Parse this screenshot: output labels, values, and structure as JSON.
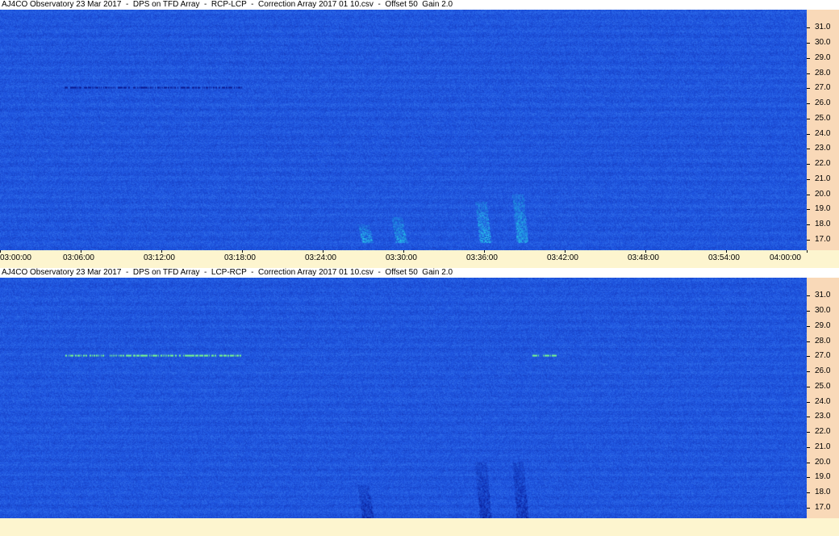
{
  "chart_data": [
    {
      "type": "heatmap",
      "title": "AJ4CO Observatory 23 Mar 2017  -  DPS on TFD Array  -  RCP-LCP  -  Correction Array 2017 01 10.csv  -  Offset 50  Gain 2.0",
      "xlabel": "",
      "ylabel": "",
      "x_ticks": [
        "03:00:00",
        "03:06:00",
        "03:12:00",
        "03:18:00",
        "03:24:00",
        "03:30:00",
        "03:36:00",
        "03:42:00",
        "03:48:00",
        "03:54:00",
        "04:00:00"
      ],
      "y_ticks": [
        "31.0",
        "30.0",
        "29.0",
        "28.0",
        "27.0",
        "26.0",
        "25.0",
        "24.0",
        "23.0",
        "22.0",
        "21.0",
        "20.0",
        "19.0",
        "18.0",
        "17.0"
      ],
      "ylim": [
        16.3,
        32.2
      ],
      "colors": {
        "base": "#1e55e0",
        "bright": "#2ee8f0",
        "dark": "#0a1890"
      },
      "features": [
        {
          "kind": "dark-line",
          "freq": 27.1,
          "x_start": 0.08,
          "x_end": 0.3
        },
        {
          "kind": "burst",
          "time": "03:27:00",
          "freq_range": [
            16.8,
            18.0
          ]
        },
        {
          "kind": "burst",
          "time": "03:29:30",
          "freq_range": [
            16.8,
            18.5
          ]
        },
        {
          "kind": "burst",
          "time": "03:35:45",
          "freq_range": [
            16.8,
            19.5
          ]
        },
        {
          "kind": "burst",
          "time": "03:38:30",
          "freq_range": [
            16.8,
            20.0
          ]
        }
      ]
    },
    {
      "type": "heatmap",
      "title": "AJ4CO Observatory 23 Mar 2017  -  DPS on TFD Array  -  LCP-RCP  -  Correction Array 2017 01 10.csv  -  Offset 50  Gain 2.0",
      "xlabel": "",
      "ylabel": "",
      "x_ticks": [],
      "y_ticks": [
        "31.0",
        "30.0",
        "29.0",
        "28.0",
        "27.0",
        "26.0",
        "25.0",
        "24.0",
        "23.0",
        "22.0",
        "21.0",
        "20.0",
        "19.0",
        "18.0",
        "17.0"
      ],
      "ylim": [
        16.3,
        32.2
      ],
      "colors": {
        "base": "#1e55e0",
        "bright": "#7dff8a",
        "dark": "#0a1890"
      },
      "features": [
        {
          "kind": "bright-line",
          "freq": 27.1,
          "x_start": 0.08,
          "x_end": 0.3
        },
        {
          "kind": "bright-line",
          "freq": 27.1,
          "x_start": 0.66,
          "x_end": 0.69
        },
        {
          "kind": "dark-burst",
          "time": "03:27:00",
          "freq_range": [
            16.3,
            18.5
          ]
        },
        {
          "kind": "dark-burst",
          "time": "03:35:45",
          "freq_range": [
            16.3,
            20.0
          ]
        },
        {
          "kind": "dark-burst",
          "time": "03:38:30",
          "freq_range": [
            16.3,
            20.0
          ]
        }
      ]
    }
  ]
}
